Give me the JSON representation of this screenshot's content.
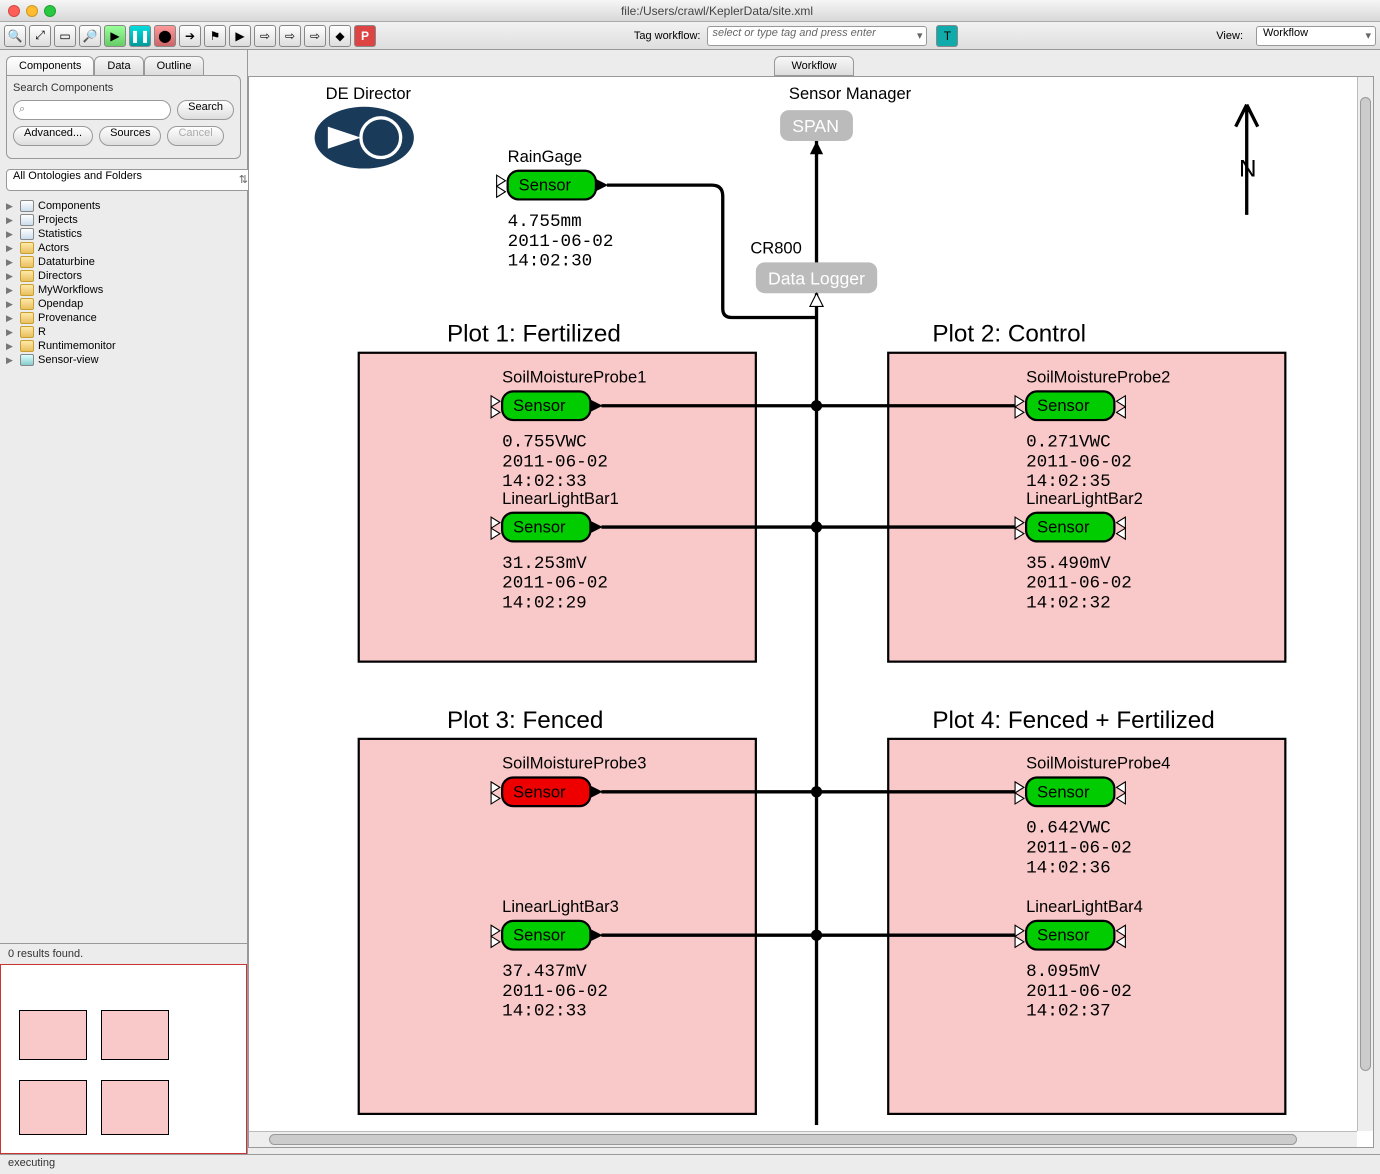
{
  "window": {
    "path": "file:/Users/crawl/KeplerData/site.xml"
  },
  "toolbar": {
    "tag_label": "Tag workflow:",
    "tag_placeholder": "select or type tag and press enter",
    "p_label": "P",
    "view_label": "View:",
    "view_value": "Workflow"
  },
  "side": {
    "tabs": [
      "Components",
      "Data",
      "Outline"
    ],
    "panel_title": "Search Components",
    "search_btn": "Search",
    "advanced_btn": "Advanced...",
    "sources_btn": "Sources",
    "cancel_btn": "Cancel",
    "onto_sel": "All Ontologies and Folders",
    "tree": [
      {
        "icon": "c",
        "label": "Components"
      },
      {
        "icon": "c",
        "label": "Projects"
      },
      {
        "icon": "c",
        "label": "Statistics"
      },
      {
        "icon": "f",
        "label": "Actors"
      },
      {
        "icon": "f",
        "label": "Dataturbine"
      },
      {
        "icon": "f",
        "label": "Directors"
      },
      {
        "icon": "f",
        "label": "MyWorkflows"
      },
      {
        "icon": "f",
        "label": "Opendap"
      },
      {
        "icon": "f",
        "label": "Provenance"
      },
      {
        "icon": "f",
        "label": "R"
      },
      {
        "icon": "f",
        "label": "Runtimemonitor"
      },
      {
        "icon": "t",
        "label": "Sensor-view"
      }
    ],
    "results": "0 results found."
  },
  "canvas": {
    "tab": "Workflow",
    "director": "DE Director",
    "compass": "N",
    "manager": {
      "title": "Sensor Manager",
      "span": "SPAN",
      "cr800": "CR800",
      "logger": "Data Logger"
    },
    "rain": {
      "name": "RainGage",
      "sensor": "Sensor",
      "l1": "4.755mm",
      "l2": "2011-06-02",
      "l3": "14:02:30"
    },
    "plots": [
      {
        "title": "Plot 1: Fertilized",
        "sensors": [
          {
            "name": "SoilMoistureProbe1",
            "status": "ok",
            "l1": "0.755VWC",
            "l2": "2011-06-02",
            "l3": "14:02:33"
          },
          {
            "name": "LinearLightBar1",
            "status": "ok",
            "l1": "31.253mV",
            "l2": "2011-06-02",
            "l3": "14:02:29"
          }
        ]
      },
      {
        "title": "Plot 2: Control",
        "sensors": [
          {
            "name": "SoilMoistureProbe2",
            "status": "ok",
            "l1": "0.271VWC",
            "l2": "2011-06-02",
            "l3": "14:02:35"
          },
          {
            "name": "LinearLightBar2",
            "status": "ok",
            "l1": "35.490mV",
            "l2": "2011-06-02",
            "l3": "14:02:32"
          }
        ]
      },
      {
        "title": "Plot 3: Fenced",
        "sensors": [
          {
            "name": "SoilMoistureProbe3",
            "status": "bad",
            "l1": "",
            "l2": "",
            "l3": ""
          },
          {
            "name": "LinearLightBar3",
            "status": "ok",
            "l1": "37.437mV",
            "l2": "2011-06-02",
            "l3": "14:02:33"
          }
        ]
      },
      {
        "title": "Plot 4: Fenced + Fertilized",
        "sensors": [
          {
            "name": "SoilMoistureProbe4",
            "status": "ok",
            "l1": "0.642VWC",
            "l2": "2011-06-02",
            "l3": "14:02:36"
          },
          {
            "name": "LinearLightBar4",
            "status": "ok",
            "l1": "8.095mV",
            "l2": "2011-06-02",
            "l3": "14:02:37"
          }
        ]
      }
    ],
    "sensor_text": "Sensor"
  },
  "status": "executing"
}
